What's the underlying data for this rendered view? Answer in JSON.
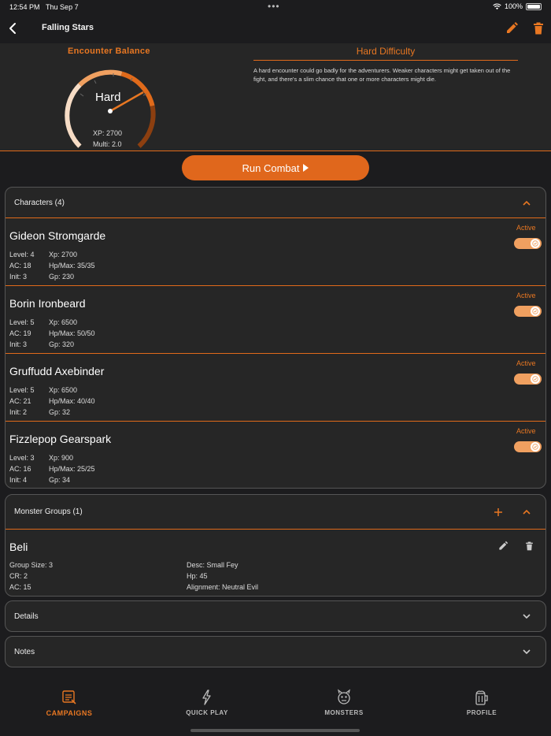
{
  "status_bar": {
    "time": "12:54 PM",
    "date": "Thu Sep 7",
    "battery": "100%"
  },
  "nav": {
    "title": "Falling Stars"
  },
  "encounter": {
    "balance_title": "Encounter Balance",
    "difficulty_label": "Hard",
    "xp": "XP: 2700",
    "multi": "Multi: 2.0",
    "difficulty_title": "Hard Difficulty",
    "difficulty_desc": "A hard encounter could go badly for the adventurers. Weaker characters might get taken out of the fight, and there's a slim chance that one or more characters might die."
  },
  "run_combat": {
    "label": "Run Combat"
  },
  "characters": {
    "header": "Characters (4)",
    "items": [
      {
        "name": "Gideon Stromgarde",
        "level": "Level: 4",
        "ac": "AC: 18",
        "init": "Init: 3",
        "xp": "Xp: 2700",
        "hp": "Hp/Max: 35/35",
        "gp": "Gp: 230",
        "status": "Active",
        "active": true
      },
      {
        "name": "Borin Ironbeard",
        "level": "Level: 5",
        "ac": "AC: 19",
        "init": "Init: 3",
        "xp": "Xp: 6500",
        "hp": "Hp/Max: 50/50",
        "gp": "Gp: 320",
        "status": "Active",
        "active": true
      },
      {
        "name": "Gruffudd Axebinder",
        "level": "Level: 5",
        "ac": "AC: 21",
        "init": "Init: 2",
        "xp": "Xp: 6500",
        "hp": "Hp/Max: 40/40",
        "gp": "Gp: 32",
        "status": "Active",
        "active": true
      },
      {
        "name": "Fizzlepop Gearspark",
        "level": "Level: 3",
        "ac": "AC: 16",
        "init": "Init: 4",
        "xp": "Xp: 900",
        "hp": "Hp/Max: 25/25",
        "gp": "Gp: 34",
        "status": "Active",
        "active": true
      }
    ]
  },
  "monster_groups": {
    "header": "Monster Groups (1)",
    "items": [
      {
        "name": "Beli",
        "group_size": "Group Size: 3",
        "cr": "CR: 2",
        "ac": "AC: 15",
        "desc": "Desc: Small Fey",
        "hp": "Hp: 45",
        "alignment": "Alignment: Neutral Evil"
      }
    ]
  },
  "details": {
    "label": "Details"
  },
  "notes": {
    "label": "Notes"
  },
  "tabs": [
    {
      "label": "CAMPAIGNS",
      "icon": "scroll-icon",
      "active": true
    },
    {
      "label": "QUICK PLAY",
      "icon": "lightning-icon",
      "active": false
    },
    {
      "label": "MONSTERS",
      "icon": "monster-icon",
      "active": false
    },
    {
      "label": "PROFILE",
      "icon": "tankard-icon",
      "active": false
    }
  ],
  "colors": {
    "accent": "#e87722",
    "background": "#1c1c1e",
    "card": "#262626"
  }
}
